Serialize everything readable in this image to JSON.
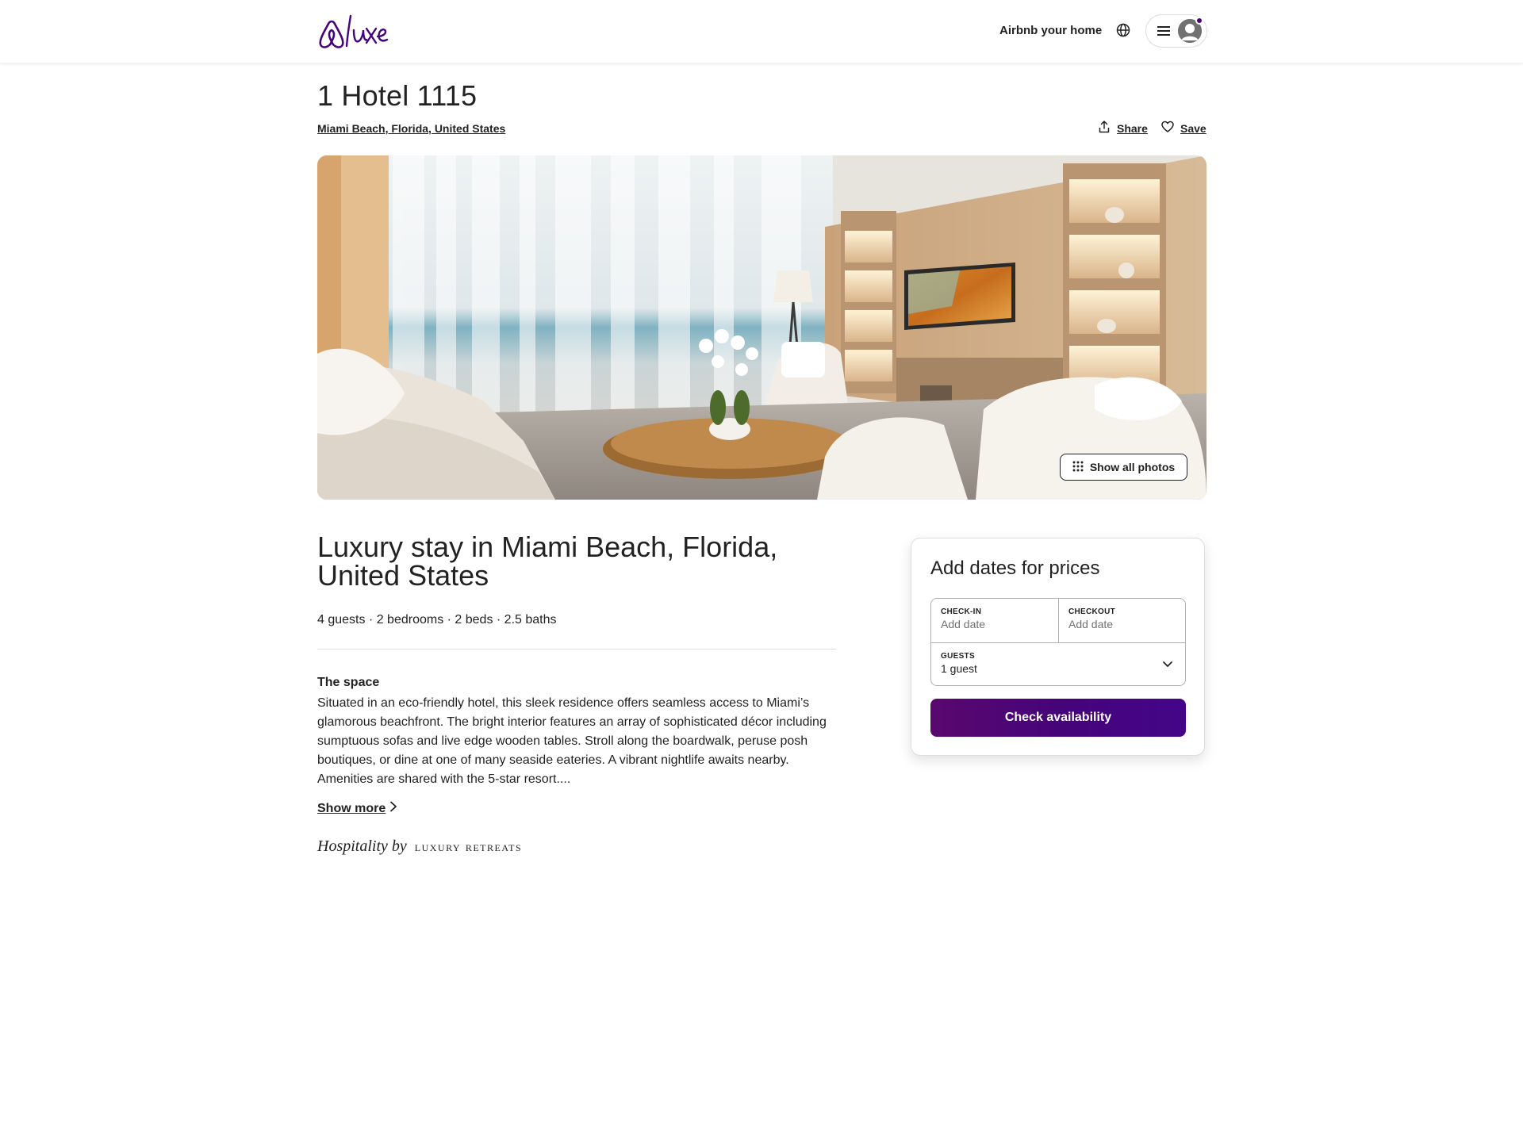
{
  "header": {
    "logo_alt": "Airbnb Luxe",
    "host_link": "Airbnb your home",
    "globe_icon": "globe-icon",
    "menu_icon": "hamburger-icon",
    "avatar_icon": "user-avatar-icon",
    "brand_color": "#460479"
  },
  "listing": {
    "title": "1 Hotel 1115",
    "location": "Miami Beach, Florida, United States",
    "share_label": "Share",
    "save_label": "Save",
    "show_photos_label": "Show all photos",
    "photo_alt": "Living room with ocean view"
  },
  "details": {
    "heading": "Luxury stay in Miami Beach, Florida, United States",
    "facts": "4 guests · 2 bedrooms · 2 beds · 2.5 baths",
    "space_title": "The space",
    "space_text": "Situated in an eco-friendly hotel, this sleek residence offers seamless access to Miami’s glamorous beachfront. The bright interior features an array of sophisticated décor including sumptuous sofas and live edge wooden tables. Stroll along the boardwalk, peruse posh boutiques, or dine at one of many seaside eateries. A vibrant nightlife awaits nearby. Amenities are shared with the 5-star resort....",
    "show_more": "Show more",
    "hospitality_by": "Hospitality by",
    "hospitality_brand": "LUXURY RETREATS"
  },
  "booking": {
    "title": "Add dates for prices",
    "checkin_label": "CHECK-IN",
    "checkin_value": "Add date",
    "checkout_label": "CHECKOUT",
    "checkout_value": "Add date",
    "guests_label": "GUESTS",
    "guests_value": "1 guest",
    "button_label": "Check availability",
    "button_color": "#460479"
  }
}
